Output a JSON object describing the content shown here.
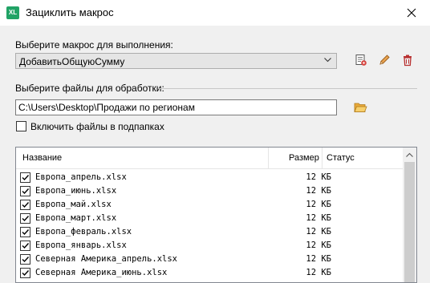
{
  "window": {
    "app_badge": "XL",
    "title": "Зациклить макрос"
  },
  "macro": {
    "label": "Выберите макрос для выполнения:",
    "selected": "ДобавитьОбщуюСумму"
  },
  "files": {
    "label": "Выберите файлы для обработки:",
    "path": "C:\\Users\\Desktop\\Продажи по регионам",
    "include_subfolders_label": "Включить файлы в подпапках",
    "include_subfolders": false
  },
  "list": {
    "columns": {
      "name": "Название",
      "size": "Размер",
      "status": "Статус"
    },
    "rows": [
      {
        "name": "Европа_апрель.xlsx",
        "size": "12 КБ",
        "status": "",
        "checked": true
      },
      {
        "name": "Европа_июнь.xlsx",
        "size": "12 КБ",
        "status": "",
        "checked": true
      },
      {
        "name": "Европа_май.xlsx",
        "size": "12 КБ",
        "status": "",
        "checked": true
      },
      {
        "name": "Европа_март.xlsx",
        "size": "12 КБ",
        "status": "",
        "checked": true
      },
      {
        "name": "Европа_февраль.xlsx",
        "size": "12 КБ",
        "status": "",
        "checked": true
      },
      {
        "name": "Европа_январь.xlsx",
        "size": "12 КБ",
        "status": "",
        "checked": true
      },
      {
        "name": "Северная Америка_апрель.xlsx",
        "size": "12 КБ",
        "status": "",
        "checked": true
      },
      {
        "name": "Северная Америка_июнь.xlsx",
        "size": "12 КБ",
        "status": "",
        "checked": true
      }
    ]
  },
  "icons": {
    "app": "excel-icon",
    "close": "close-icon",
    "dropdown": "chevron-down-icon",
    "macro_run": "macro-settings-icon",
    "edit": "pencil-icon",
    "delete": "trash-icon",
    "browse": "folder-icon",
    "scroll_up": "scroll-up-arrow-icon"
  },
  "colors": {
    "app_green": "#21a366",
    "folder": "#f2b84b",
    "pencil": "#d18a3a",
    "trash": "#c83c3c"
  }
}
